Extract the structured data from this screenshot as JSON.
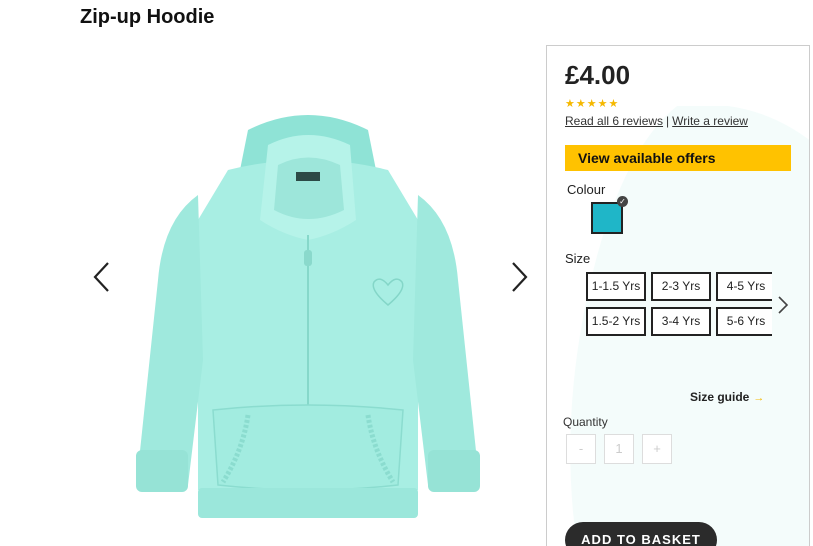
{
  "product": {
    "title": "Zip-up Hoodie",
    "price": "£4.00",
    "rating_stars": "★★★★★",
    "read_reviews": "Read all 6 reviews",
    "review_separator": "|",
    "write_review": "Write a review",
    "offers_label": "View available offers",
    "colour_label": "Colour",
    "selected_colour_hex": "#1fb6c8",
    "size_label": "Size",
    "sizes": [
      "1-1.5 Yrs",
      "2-3 Yrs",
      "4-5 Yrs",
      "1.5-2 Yrs",
      "3-4 Yrs",
      "5-6 Yrs"
    ],
    "size_guide": "Size guide",
    "size_guide_arrow": "→",
    "quantity_label": "Quantity",
    "quantity_value": "1",
    "qty_minus": "-",
    "qty_plus": "+",
    "add_to_basket": "ADD TO BASKET"
  },
  "colors": {
    "accent": "#ffc200",
    "hoodie": "#a8eee3",
    "button_dark": "#2b2b2b"
  },
  "icons": {
    "prev": "chevron-left-icon",
    "next": "chevron-right-icon",
    "size_next": "chevron-right-icon",
    "selected": "check-icon"
  }
}
